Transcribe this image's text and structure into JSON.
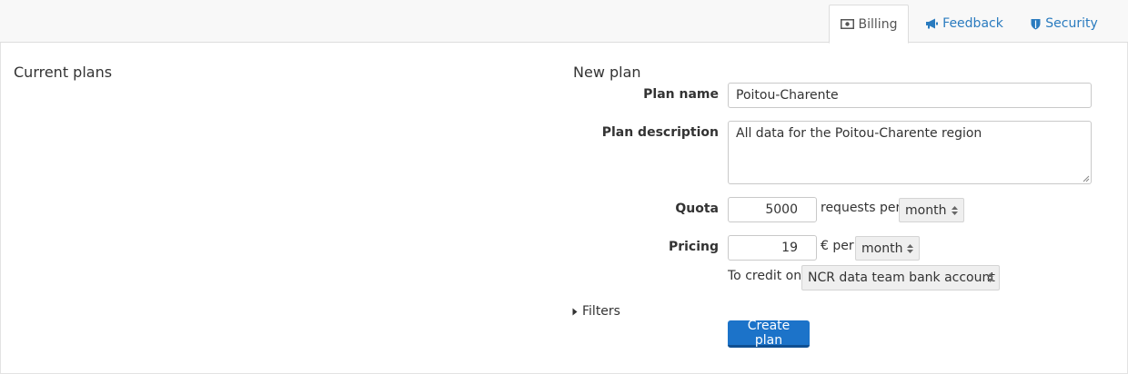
{
  "tabs": [
    {
      "label": "Billing",
      "icon": "money-icon",
      "active": true
    },
    {
      "label": "Feedback",
      "icon": "megaphone-icon",
      "active": false
    },
    {
      "label": "Security",
      "icon": "shield-icon",
      "active": false
    }
  ],
  "current_plans": {
    "title": "Current plans"
  },
  "new_plan": {
    "title": "New plan",
    "plan_name": {
      "label": "Plan name",
      "value": "Poitou-Charente"
    },
    "plan_description": {
      "label": "Plan description",
      "value": "All data for the Poitou-Charente region"
    },
    "quota": {
      "label": "Quota",
      "value": "5000",
      "unit_text": "requests per",
      "period": "month"
    },
    "pricing": {
      "label": "Pricing",
      "value": "19",
      "unit_text": "€ per",
      "period": "month"
    },
    "credit": {
      "label": "To credit on",
      "account": "NCR data team bank account"
    },
    "filters": {
      "label": "Filters"
    },
    "submit": {
      "label": "Create plan"
    }
  },
  "colors": {
    "accent": "#1c73c9",
    "link": "#2a7bbf"
  }
}
